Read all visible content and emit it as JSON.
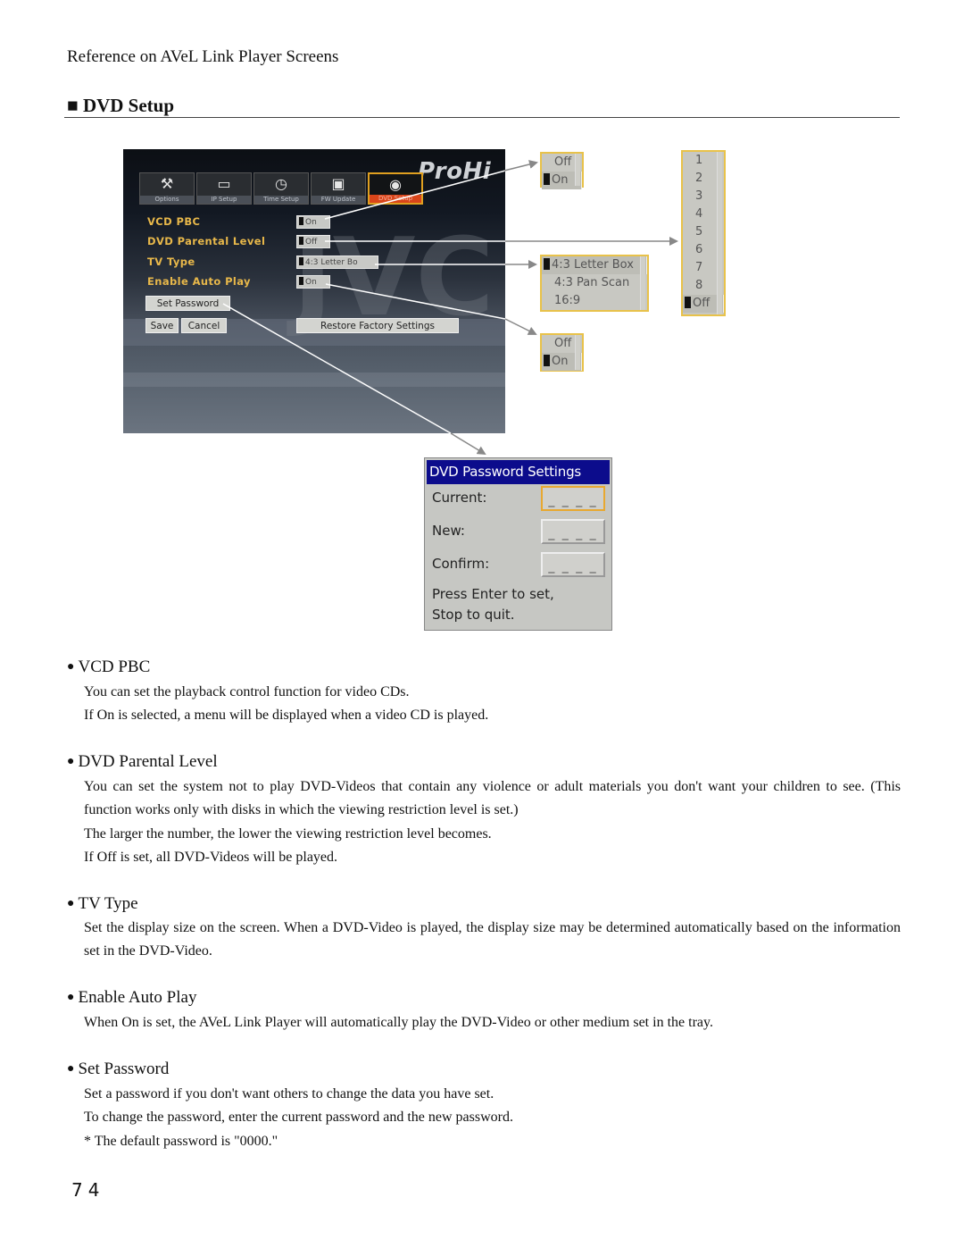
{
  "header": {
    "running_head": "Reference on AVeL Link Player Screens",
    "section_marker": "■",
    "section_title": "DVD Setup"
  },
  "screen": {
    "brand_logo": "ProHi",
    "watermark": "JVC",
    "tabs": [
      {
        "label": "Options",
        "icon": "tools-icon",
        "glyph": "⚒",
        "active": false
      },
      {
        "label": "IP Setup",
        "icon": "network-icon",
        "glyph": "▭",
        "active": false
      },
      {
        "label": "Time Setup",
        "icon": "clock-icon",
        "glyph": "◷",
        "active": false
      },
      {
        "label": "FW Update",
        "icon": "chip-icon",
        "glyph": "▣",
        "active": false
      },
      {
        "label": "DVD Setup",
        "icon": "disc-icon",
        "glyph": "◉",
        "active": true
      }
    ],
    "settings": [
      {
        "label": "VCD PBC",
        "value": "On"
      },
      {
        "label": "DVD Parental Level",
        "value": "Off"
      },
      {
        "label": "TV Type",
        "value": "4:3 Letter Bo"
      },
      {
        "label": "Enable Auto Play",
        "value": "On"
      }
    ],
    "buttons": {
      "set_password": "Set Password",
      "save": "Save",
      "cancel": "Cancel",
      "restore": "Restore Factory Settings"
    }
  },
  "popups": {
    "vcd_pbc": {
      "options": [
        "Off",
        "On"
      ],
      "selected": "On"
    },
    "parental_level": {
      "options": [
        "1",
        "2",
        "3",
        "4",
        "5",
        "6",
        "7",
        "8",
        "Off"
      ],
      "selected": "Off"
    },
    "tv_type": {
      "options": [
        "4:3 Letter Box",
        "4:3 Pan Scan",
        "16:9"
      ],
      "selected": "4:3 Letter Box"
    },
    "auto_play": {
      "options": [
        "Off",
        "On"
      ],
      "selected": "On"
    }
  },
  "password_dialog": {
    "title": "DVD Password Settings",
    "fields": [
      {
        "label": "Current:",
        "value": "_ _ _ _",
        "focused": true
      },
      {
        "label": "New:",
        "value": "_ _ _ _",
        "focused": false
      },
      {
        "label": "Confirm:",
        "value": "_ _ _ _",
        "focused": false
      }
    ],
    "note_line1": "Press Enter to set,",
    "note_line2": "Stop to quit."
  },
  "descriptions": [
    {
      "heading": "VCD PBC",
      "lines": [
        "You can set the playback control function for video CDs.",
        "If On is selected, a menu will be displayed when a video CD is played."
      ]
    },
    {
      "heading": "DVD Parental Level",
      "lines": [
        "You can set the system not to play DVD-Videos that contain any violence or adult materials you don't want your children to see. (This function works only with disks in which the viewing restriction level is set.)",
        "The larger the number, the lower the viewing restriction level becomes.",
        "If Off is set, all DVD-Videos will be played."
      ]
    },
    {
      "heading": "TV Type",
      "lines": [
        "Set the display size on the screen. When a DVD-Video is played, the display size may be determined automatically based on the information set in the DVD-Video."
      ]
    },
    {
      "heading": "Enable Auto Play",
      "lines": [
        "When On is set, the AVeL Link Player will automatically play the DVD-Video or other medium set in the tray."
      ]
    },
    {
      "heading": "Set Password",
      "lines": [
        "Set a password if you don't want others to change the data you have set.",
        "To change the password, enter the current password and the new password.",
        "* The default password is \"0000.\""
      ]
    }
  ],
  "bullet": "●",
  "page_number": "74"
}
